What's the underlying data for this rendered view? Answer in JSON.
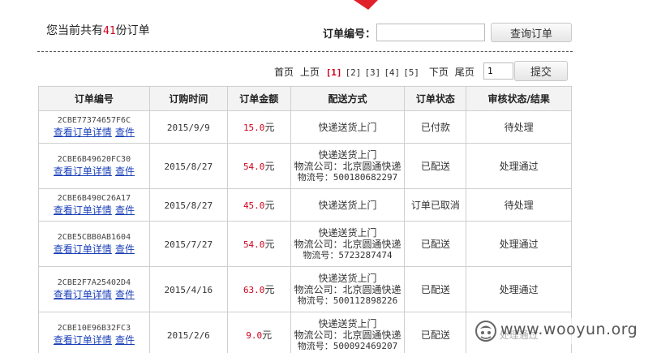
{
  "summary": {
    "prefix": "您当前共有",
    "count": "41",
    "suffix": "份订单"
  },
  "search": {
    "label": "订单编号：",
    "value": "",
    "button": "查询订单"
  },
  "pager": {
    "first": "首页",
    "prev": "上页",
    "pages": [
      "[1]",
      "[2]",
      "[3]",
      "[4]",
      "[5]"
    ],
    "current_index": 0,
    "next": "下页",
    "last": "尾页",
    "input_value": "1",
    "submit": "提交"
  },
  "table": {
    "headers": [
      "订单编号",
      "订购时间",
      "订单金额",
      "配送方式",
      "订单状态",
      "审核状态/结果"
    ],
    "detail_link": "查看订单详情",
    "cancel_link": "查件",
    "currency_unit": "元",
    "rows": [
      {
        "id": "2CBE77374657F6C",
        "date": "2015/9/9",
        "amount": "15.0",
        "ship": [
          "快递送货上门"
        ],
        "status": "已付款",
        "review": "待处理"
      },
      {
        "id": "2CBE6B49620FC30",
        "date": "2015/8/27",
        "amount": "54.0",
        "ship": [
          "快递送货上门",
          "物流公司：北京圆通快递",
          "物流号：500180682297"
        ],
        "status": "已配送",
        "review": "处理通过"
      },
      {
        "id": "2CBE6B490C26A17",
        "date": "2015/8/27",
        "amount": "45.0",
        "ship": [
          "快递送货上门"
        ],
        "status": "订单已取消",
        "review": "待处理"
      },
      {
        "id": "2CBE5CBB0AB1604",
        "date": "2015/7/27",
        "amount": "54.0",
        "ship": [
          "快递送货上门",
          "物流公司：北京圆通快递",
          "物流号：5723287474"
        ],
        "status": "已配送",
        "review": "处理通过"
      },
      {
        "id": "2CBE2F7A25402D4",
        "date": "2015/4/16",
        "amount": "63.0",
        "ship": [
          "快递送货上门",
          "物流公司：北京圆通快递",
          "物流号：500112898226"
        ],
        "status": "已配送",
        "review": "处理通过"
      },
      {
        "id": "2CBE10E96B32FC3",
        "date": "2015/2/6",
        "amount": "9.0",
        "ship": [
          "快递送货上门",
          "物流公司：北京圆通快递",
          "物流号：500092469207"
        ],
        "status": "已配送",
        "review": "处理通过"
      }
    ]
  },
  "watermark": {
    "text": "www.wooyun.org",
    "icon": "wooyun-logo-icon"
  },
  "colors": {
    "accent_red": "#d0021b",
    "link_blue": "#1a3fb8",
    "header_bg": "#f3f3f3"
  }
}
